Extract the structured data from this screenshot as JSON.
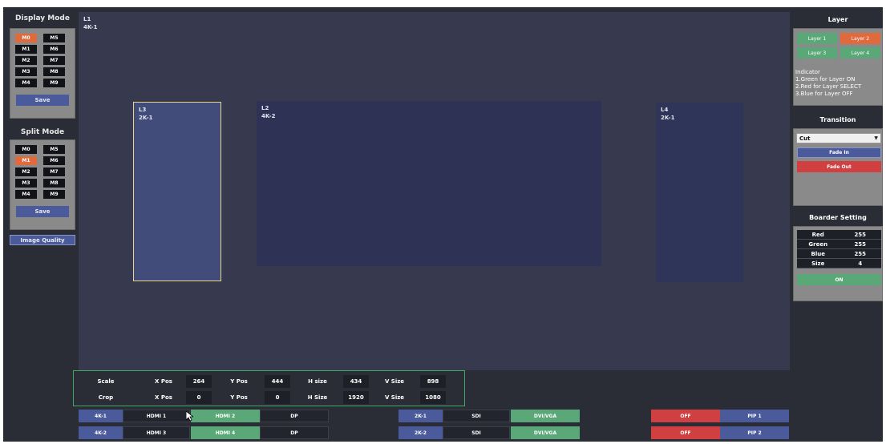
{
  "display_mode": {
    "title": "Display Mode",
    "left_col": [
      "M0",
      "M1",
      "M2",
      "M3",
      "M4"
    ],
    "right_col": [
      "M5",
      "M6",
      "M7",
      "M8",
      "M9"
    ],
    "active": "M0",
    "save_label": "Save"
  },
  "split_mode": {
    "title": "Split Mode",
    "left_col": [
      "M0",
      "M1",
      "M2",
      "M3",
      "M4"
    ],
    "right_col": [
      "M5",
      "M6",
      "M7",
      "M8",
      "M9"
    ],
    "active": "M1",
    "save_label": "Save"
  },
  "image_quality_label": "Image Quality",
  "canvas": {
    "layers": [
      {
        "id": "L1",
        "source": "4K-1"
      },
      {
        "id": "L3",
        "source": "2K-1"
      },
      {
        "id": "L2",
        "source": "4K-2"
      },
      {
        "id": "L4",
        "source": "2K-1"
      }
    ]
  },
  "layer_panel": {
    "title": "Layer",
    "buttons": [
      {
        "label": "Layer 1",
        "state": "on"
      },
      {
        "label": "Layer 2",
        "state": "select"
      },
      {
        "label": "Layer 3",
        "state": "on"
      },
      {
        "label": "Layer 4",
        "state": "on"
      }
    ],
    "indicator": {
      "title": "Indicator",
      "line1": "1.Green for Layer ON",
      "line2": "2.Red for Layer SELECT",
      "line3": "3.Blue for Layer OFF"
    }
  },
  "transition": {
    "title": "Transition",
    "selected": "Cut",
    "fade_in_label": "Fade In",
    "fade_out_label": "Fade Out"
  },
  "border_setting": {
    "title": "Boarder Setting",
    "rows": [
      {
        "label": "Red",
        "value": "255"
      },
      {
        "label": "Green",
        "value": "255"
      },
      {
        "label": "Blue",
        "value": "255"
      },
      {
        "label": "Size",
        "value": "4"
      }
    ],
    "toggle_label": "ON"
  },
  "params": {
    "scale": {
      "label": "Scale",
      "xpos_label": "X Pos",
      "xpos": "264",
      "ypos_label": "Y Pos",
      "ypos": "444",
      "hsize_label": "H size",
      "hsize": "434",
      "vsize_label": "V Size",
      "vsize": "898"
    },
    "crop": {
      "label": "Crop",
      "xpos_label": "X Pos",
      "xpos": "0",
      "ypos_label": "Y Pos",
      "ypos": "0",
      "hsize_label": "H Size",
      "hsize": "1920",
      "vsize_label": "V Size",
      "vsize": "1080"
    }
  },
  "sources": {
    "row1": [
      "4K-1",
      "HDMI 1",
      "HDMI 2",
      "DP",
      "2K-1",
      "SDI",
      "DVI/VGA",
      "OFF",
      "PIP 1"
    ],
    "row2": [
      "4K-2",
      "HDMI 3",
      "HDMI 4",
      "DP",
      "2K-2",
      "SDI",
      "DVI/VGA",
      "OFF",
      "PIP 2"
    ]
  },
  "colors": {
    "active_orange": "#e06a3c",
    "layer_on_green": "#5aa878",
    "select_red": "#d04040",
    "blue_button": "#4a5a9a",
    "canvas_bg": "#373a4e",
    "frame_bg": "#2a2c36",
    "highlight_yellow": "#e8d88a",
    "params_border": "#3fa865"
  }
}
